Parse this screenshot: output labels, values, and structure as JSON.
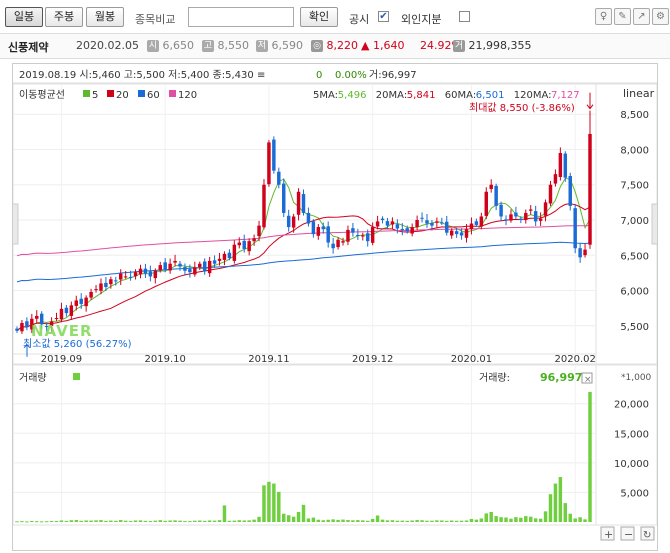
{
  "toolbar": {
    "period_tabs": [
      "일봉",
      "주봉",
      "월봉"
    ],
    "compare_label": "종목비교",
    "confirm_label": "확인",
    "notice_label": "공시",
    "notice_checked": true,
    "foreign_label": "외인지분",
    "foreign_checked": false
  },
  "stock": {
    "name": "신풍제약",
    "date": "2020.02.05",
    "open_tag": "시",
    "open": "6,650",
    "high_tag": "고",
    "high": "8,550",
    "low_tag": "저",
    "low": "6,590",
    "close": "8,220",
    "change": "▲ 1,640",
    "change_pct": "24.92%",
    "volume": "21,998,355",
    "colors": {
      "up": "#d0021b",
      "down": "#1a6bd6"
    }
  },
  "chart_data": {
    "type": "candlestick",
    "hover": {
      "date": "2019.08.19",
      "text_left": "2019.08.19  시:5,460  고:5,500  저:5,400  종:5,430 ≡",
      "change": "0",
      "change_pct": "0.00%",
      "volume_text": "거:96,997"
    },
    "ma_legend": {
      "title": "이동평균선",
      "items": [
        {
          "label": "5",
          "color": "#5fb92d"
        },
        {
          "label": "20",
          "color": "#d0021b"
        },
        {
          "label": "60",
          "color": "#1a6bd6"
        },
        {
          "label": "120",
          "color": "#e04fa3"
        }
      ]
    },
    "ma_values": [
      {
        "label": "5MA:",
        "value": "5,496",
        "color": "#5fb92d"
      },
      {
        "label": "20MA:",
        "value": "5,841",
        "color": "#d0021b"
      },
      {
        "label": "60MA:",
        "value": "6,501",
        "color": "#1a6bd6"
      },
      {
        "label": "120MA:",
        "value": "7,127",
        "color": "#e04fa3"
      }
    ],
    "scale_label": "linear",
    "max_annotation": "최대값 8,550 (-3.86%)",
    "min_annotation": "최소값 5,260 (56.27%)",
    "price_axis": {
      "min": 5100,
      "max": 8900,
      "ticks": [
        5500,
        6000,
        6500,
        7000,
        7500,
        8000,
        8500
      ],
      "tick_labels": [
        "5,500",
        "6,000",
        "6,500",
        "7,000",
        "7,500",
        "8,000",
        "8,500"
      ]
    },
    "x_labels": [
      {
        "label": "2019.09",
        "index": 9
      },
      {
        "label": "2019.10",
        "index": 30
      },
      {
        "label": "2019.11",
        "index": 51
      },
      {
        "label": "2019.12",
        "index": 72
      },
      {
        "label": "2020.01",
        "index": 92
      },
      {
        "label": "2020.02",
        "index": 113
      }
    ],
    "closes": [
      5430,
      5540,
      5480,
      5600,
      5640,
      5520,
      5490,
      5560,
      5610,
      5740,
      5680,
      5790,
      5860,
      5810,
      5900,
      5980,
      6020,
      6100,
      6050,
      6160,
      6140,
      6240,
      6200,
      6180,
      6260,
      6310,
      6240,
      6200,
      6280,
      6360,
      6300,
      6380,
      6420,
      6340,
      6280,
      6260,
      6330,
      6380,
      6270,
      6420,
      6380,
      6450,
      6520,
      6460,
      6650,
      6680,
      6590,
      6700,
      6740,
      6920,
      7500,
      8100,
      7700,
      7500,
      7100,
      6900,
      7050,
      7400,
      7100,
      6950,
      6800,
      6900,
      6870,
      6680,
      6600,
      6720,
      6700,
      6860,
      6820,
      6780,
      6780,
      6700,
      6900,
      6980,
      7000,
      6920,
      6980,
      6880,
      6860,
      6840,
      6900,
      7000,
      7020,
      6950,
      6920,
      6980,
      6960,
      6820,
      6850,
      6800,
      6780,
      6870,
      6950,
      6930,
      7050,
      7400,
      7500,
      7200,
      7050,
      7000,
      7080,
      7050,
      7000,
      7100,
      7150,
      6980,
      7020,
      7250,
      7500,
      7650,
      7950,
      7600,
      7200,
      6600,
      6470,
      6580,
      8220
    ],
    "volume_axis": {
      "max": 23000,
      "ticks": [
        5000,
        10000,
        15000,
        20000
      ],
      "tick_labels": [
        "5,000",
        "10,000",
        "15,000",
        "20,000"
      ],
      "unit_label": "*1,000"
    },
    "volume_title": "거래량",
    "volume_info_label": "거래량:",
    "volume_info_value": "96,997",
    "volumes": [
      120,
      150,
      100,
      180,
      140,
      110,
      130,
      170,
      160,
      260,
      180,
      300,
      330,
      200,
      260,
      240,
      280,
      320,
      190,
      240,
      200,
      330,
      220,
      180,
      260,
      280,
      190,
      150,
      230,
      310,
      190,
      260,
      280,
      230,
      160,
      150,
      220,
      250,
      190,
      260,
      230,
      310,
      2800,
      200,
      230,
      300,
      260,
      280,
      400,
      880,
      6200,
      6800,
      6500,
      5100,
      1400,
      1150,
      900,
      1700,
      2900,
      600,
      750,
      380,
      300,
      380,
      450,
      360,
      410,
      330,
      290,
      320,
      280,
      210,
      520,
      1100,
      400,
      280,
      300,
      220,
      230,
      200,
      260,
      330,
      300,
      220,
      220,
      280,
      260,
      190,
      250,
      210,
      220,
      260,
      520,
      400,
      600,
      1450,
      1700,
      1000,
      820,
      760,
      560,
      820,
      720,
      1000,
      900,
      620,
      560,
      1800,
      4700,
      6500,
      7600,
      3200,
      1400,
      600,
      800,
      450,
      22000
    ]
  }
}
